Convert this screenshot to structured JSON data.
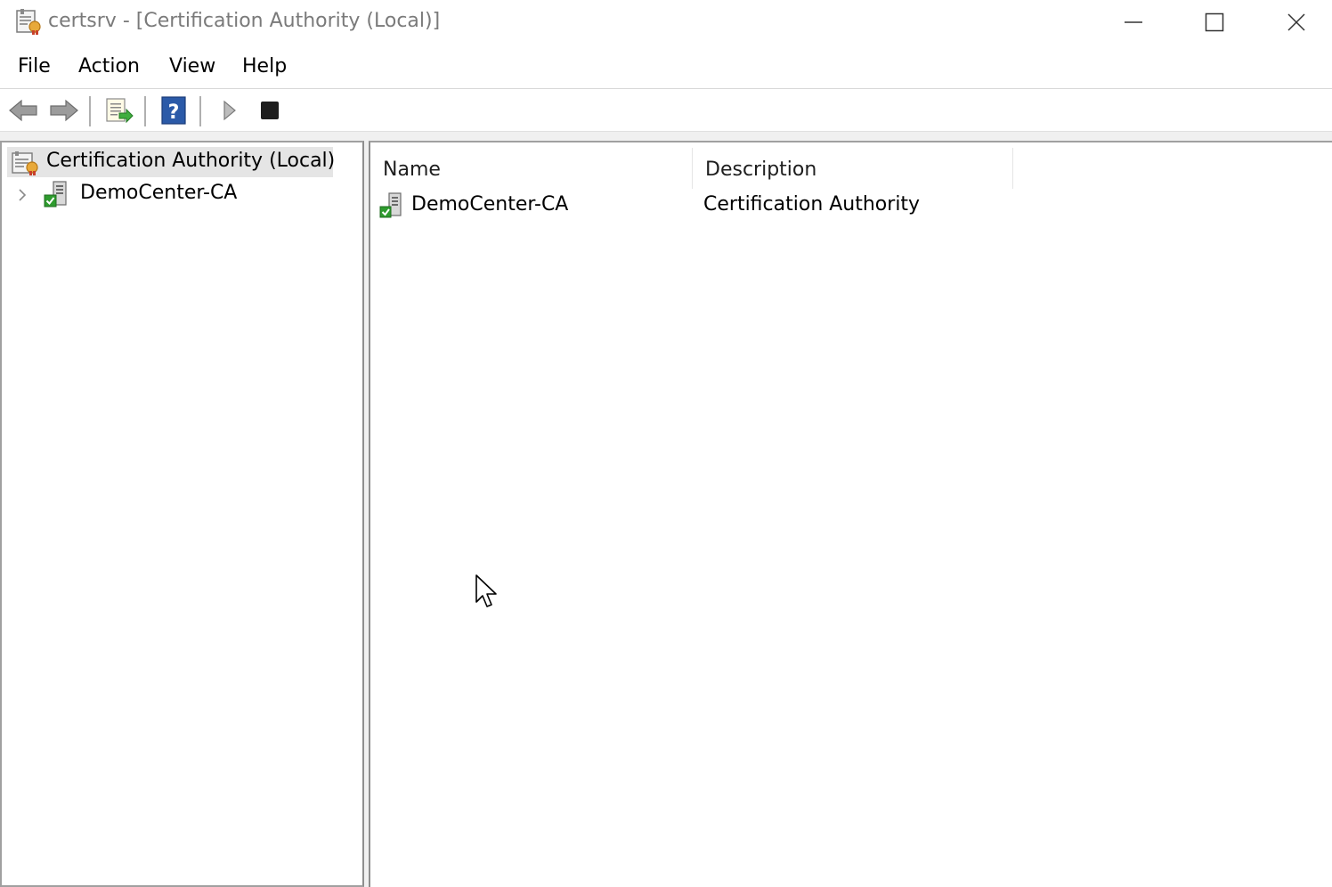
{
  "window": {
    "title": "certsrv - [Certification Authority (Local)]",
    "controls": [
      "minimize",
      "maximize",
      "close"
    ]
  },
  "menu": {
    "items": [
      {
        "label": "File"
      },
      {
        "label": "Action"
      },
      {
        "label": "View"
      },
      {
        "label": "Help"
      }
    ]
  },
  "toolbar": {
    "buttons": [
      "back-arrow-icon",
      "forward-arrow-icon",
      "export-list-icon",
      "help-icon",
      "start-service-icon",
      "stop-service-icon"
    ]
  },
  "tree": {
    "root": {
      "label": "Certification Authority (Local)",
      "selected": true
    },
    "children": [
      {
        "label": "DemoCenter-CA",
        "expanded": false
      }
    ]
  },
  "list": {
    "columns": [
      {
        "label": "Name"
      },
      {
        "label": "Description"
      }
    ],
    "rows": [
      {
        "name": "DemoCenter-CA",
        "description": "Certification Authority"
      }
    ]
  },
  "colors": {
    "selection": "#e5e5e5",
    "title_text": "#7a7a7a",
    "help_blue": "#2b5aa8",
    "ok_green": "#2e9b2e"
  }
}
